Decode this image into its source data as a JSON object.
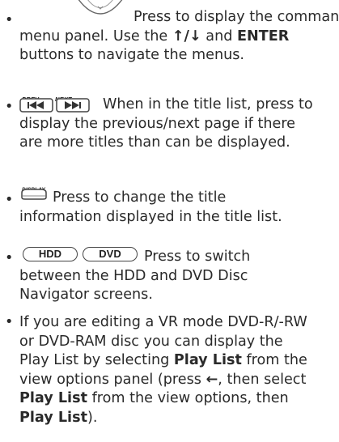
{
  "items": [
    {
      "lines": [
        [
          {
            "t": "Press to display the command"
          }
        ],
        [
          {
            "t": "menu panel. Use the "
          },
          {
            "t": "↑/↓",
            "b": true
          },
          {
            "t": " and "
          },
          {
            "t": "ENTER",
            "b": true
          }
        ],
        [
          {
            "t": "buttons to navigate the menus."
          }
        ]
      ]
    },
    {
      "prev_label": "PREV",
      "next_label": "NEXT",
      "lines": [
        [
          {
            "t": "When in the title list, press to"
          }
        ],
        [
          {
            "t": "display the previous/next page if there"
          }
        ],
        [
          {
            "t": "are more titles than can be displayed."
          }
        ]
      ]
    },
    {
      "display_label": "DISPLAY",
      "lines": [
        [
          {
            "t": "Press to change the title"
          }
        ],
        [
          {
            "t": "information displayed in the title list."
          }
        ]
      ]
    },
    {
      "hdd_label": "HDD",
      "dvd_label": "DVD",
      "lines": [
        [
          {
            "t": "Press to switch"
          }
        ],
        [
          {
            "t": "between the HDD and DVD Disc"
          }
        ],
        [
          {
            "t": "Navigator screens."
          }
        ]
      ]
    },
    {
      "lines": [
        [
          {
            "t": "If you are editing a VR mode DVD-R/-RW"
          }
        ],
        [
          {
            "t": "or DVD-RAM disc you can display the"
          }
        ],
        [
          {
            "t": "Play List by selecting "
          },
          {
            "t": "Play List",
            "b": true
          },
          {
            "t": "  from the"
          }
        ],
        [
          {
            "t": "view options panel (press "
          },
          {
            "t": "←",
            "b": true
          },
          {
            "t": ", then select"
          }
        ],
        [
          {
            "t": "Play List",
            "b": true
          },
          {
            "t": " from the view options, then"
          }
        ],
        [
          {
            "t": "Play List",
            "b": true
          },
          {
            "t": ")."
          }
        ]
      ]
    }
  ],
  "bullet_char": "•"
}
